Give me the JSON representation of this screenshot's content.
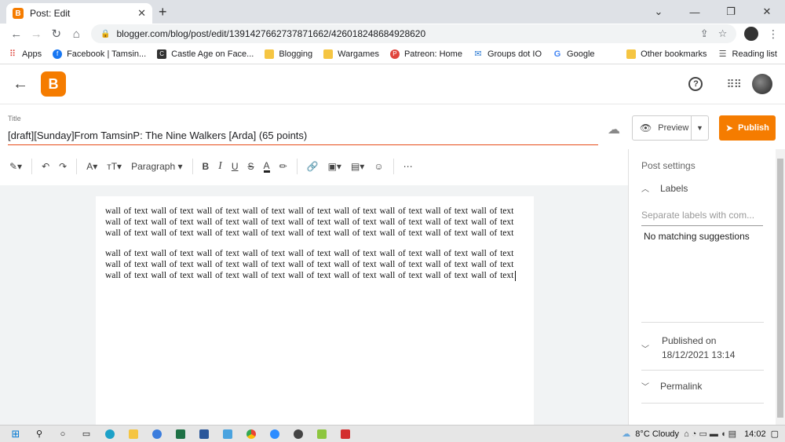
{
  "browser": {
    "tab_title": "Post: Edit",
    "tab_close": "✕",
    "new_tab": "+",
    "url": "blogger.com/blog/post/edit/1391427662737871662/426018248684928620",
    "window_controls": [
      "⌄",
      "—",
      "❐",
      "✕"
    ],
    "bookmarks": [
      {
        "label": "Apps",
        "icon": "apps-grid-icon",
        "color": "#d93025"
      },
      {
        "label": "Facebook | Tamsin...",
        "icon": "facebook-icon",
        "color": "#1877f2"
      },
      {
        "label": "Castle Age on Face...",
        "icon": "castle-age-icon",
        "color": "#333333"
      },
      {
        "label": "Blogging",
        "icon": "folder-icon",
        "color": "#f5c542"
      },
      {
        "label": "Wargames",
        "icon": "folder-icon",
        "color": "#f5c542"
      },
      {
        "label": "Patreon: Home",
        "icon": "patreon-icon",
        "color": "#e0453d"
      },
      {
        "label": "Groups dot IO",
        "icon": "mail-icon",
        "color": "#2d7bd3"
      },
      {
        "label": "Google",
        "icon": "google-icon",
        "color": "#4285f4"
      }
    ],
    "other_bookmarks": "Other bookmarks",
    "reading_list": "Reading list"
  },
  "post": {
    "title_label": "Title",
    "title": "[draft][Sunday]From TamsinP: The Nine Walkers [Arda] (65 points)",
    "preview_label": "Preview",
    "publish_label": "Publish",
    "paragraphs": [
      "wall of text wall of text wall of text wall of text wall of text wall of text wall of text wall of text wall of text wall of text wall of text wall of text wall of text wall of text wall of text wall of text wall of text wall of text wall of text wall of text wall of text wall of text wall of text wall of text wall of text wall of text wall of text",
      "wall of text wall of text wall of text wall of text wall of text wall of text wall of text wall of text wall of text wall of text wall of text wall of text wall of text wall of text wall of text wall of text wall of text wall of text wall of text wall of text wall of text wall of text wall of text wall of text wall of text wall of text wall of text"
    ]
  },
  "toolbar": {
    "paragraph_style": "Paragraph",
    "more": "⋯"
  },
  "sidebar": {
    "heading": "Post settings",
    "labels_heading": "Labels",
    "labels_placeholder": "Separate labels with com...",
    "no_match": "No matching suggestions",
    "published_label": "Published on",
    "published_date": "18/12/2021 13:14",
    "permalink": "Permalink"
  },
  "taskbar": {
    "weather": "8°C  Cloudy",
    "time": "14:02"
  },
  "colors": {
    "accent": "#f57c00",
    "title_underline": "#e64a19"
  }
}
